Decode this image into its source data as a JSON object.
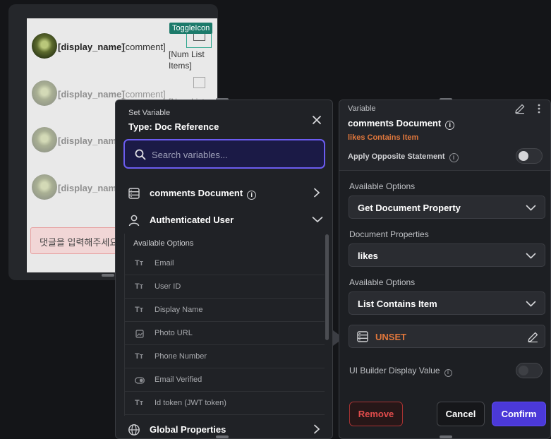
{
  "canvas": {
    "rows": [
      {
        "name": "[display_name]",
        "comment": "[comment]",
        "num_items": "[Num List Items]"
      },
      {
        "name": "[display_name]",
        "comment": "[comment]",
        "num_items": "[Num List"
      },
      {
        "name": "[display_name]",
        "comment": "",
        "num_items": ""
      },
      {
        "name": "[display_name]",
        "comment": "",
        "num_items": ""
      }
    ],
    "toggle_badge": "ToggleIcon",
    "comment_input_placeholder": "댓글을 입력해주세요"
  },
  "set_variable": {
    "kicker": "Set Variable",
    "title": "Type: Doc Reference",
    "search_placeholder": "Search variables...",
    "variables": [
      {
        "label": "comments Document",
        "icon": "collection-icon"
      },
      {
        "label": "Authenticated User",
        "icon": "user-icon"
      },
      {
        "label": "Global Properties",
        "icon": "globe-icon"
      }
    ],
    "available_options_label": "Available Options",
    "options": [
      {
        "label": "Email",
        "icon": "text-type-icon"
      },
      {
        "label": "User ID",
        "icon": "text-type-icon"
      },
      {
        "label": "Display Name",
        "icon": "text-type-icon"
      },
      {
        "label": "Photo URL",
        "icon": "image-icon"
      },
      {
        "label": "Phone Number",
        "icon": "text-type-icon"
      },
      {
        "label": "Email Verified",
        "icon": "toggle-icon"
      },
      {
        "label": "Id token (JWT token)",
        "icon": "text-type-icon"
      }
    ]
  },
  "panel": {
    "kicker": "Variable",
    "title": "comments Document",
    "subtitle": "likes Contains Item",
    "apply_opposite": "Apply Opposite Statement",
    "available_options_1_label": "Available Options",
    "available_options_1_value": "Get Document Property",
    "document_properties_label": "Document Properties",
    "document_properties_value": "likes",
    "available_options_2_label": "Available Options",
    "available_options_2_value": "List Contains Item",
    "unset_value": "UNSET",
    "ui_builder_label": "UI Builder Display Value",
    "remove_label": "Remove",
    "cancel_label": "Cancel",
    "confirm_label": "Confirm"
  },
  "colors": {
    "accent": "#4b39d8",
    "search_border": "#6b5cf0",
    "warning_orange": "#e0773c",
    "danger_red": "#e24c4c",
    "toggle_badge": "#1c7a6a"
  }
}
